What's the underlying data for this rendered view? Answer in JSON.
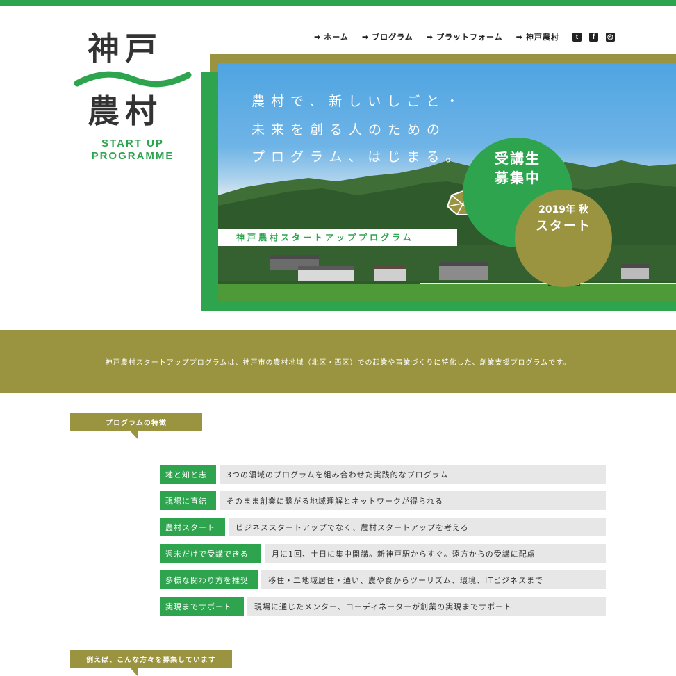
{
  "logo": {
    "line1": "神戸",
    "line2": "農村",
    "sub1": "START UP",
    "sub2": "PROGRAMME"
  },
  "nav": {
    "items": [
      {
        "label": "ホーム"
      },
      {
        "label": "プログラム"
      },
      {
        "label": "プラットフォーム"
      },
      {
        "label": "神戸農村"
      }
    ],
    "social": [
      {
        "icon": "twitter-icon",
        "glyph": "t"
      },
      {
        "icon": "facebook-icon",
        "glyph": "f"
      },
      {
        "icon": "instagram-icon",
        "glyph": "◎"
      }
    ]
  },
  "hero": {
    "tagline_line1": "農村で、新しいしごと・",
    "tagline_line2": "未来を創る人のための",
    "tagline_line3": "プログラム、はじまる。",
    "label": "神戸農村スタートアッププログラム",
    "badge_green_line1": "受講生",
    "badge_green_line2": "募集中",
    "badge_olive_line1": "2019年 秋",
    "badge_olive_line2": "スタート"
  },
  "intro": {
    "text": "神戸農村スタートアッププログラムは、神戸市の農村地域（北区・西区）での起業や事業づくりに特化した、創業支援プログラムです。"
  },
  "sections": {
    "features_title": "プログラムの特徴",
    "recruit_title": "例えば、こんな方々を募集しています"
  },
  "features": [
    {
      "tag": "地と知と志",
      "desc": "3つの領域のプログラムを組み合わせた実践的なプログラム"
    },
    {
      "tag": "現場に直結",
      "desc": "そのまま創業に繋がる地域理解とネットワークが得られる"
    },
    {
      "tag": "農村スタート",
      "desc": "ビジネススタートアップでなく、農村スタートアップを考える"
    },
    {
      "tag": "週末だけで受講できる",
      "desc": "月に1回、土日に集中開講。新神戸駅からすぐ。遠方からの受講に配慮"
    },
    {
      "tag": "多様な関わり方を推奨",
      "desc": "移住・二地域居住・通い、農や食からツーリズム、環境、ITビジネスまで"
    },
    {
      "tag": "実現までサポート",
      "desc": "現場に通じたメンター、コーディネーターが創業の実現までサポート"
    }
  ],
  "colors": {
    "green": "#2ea44f",
    "olive": "#9a9441",
    "gray": "#e7e7e7"
  }
}
